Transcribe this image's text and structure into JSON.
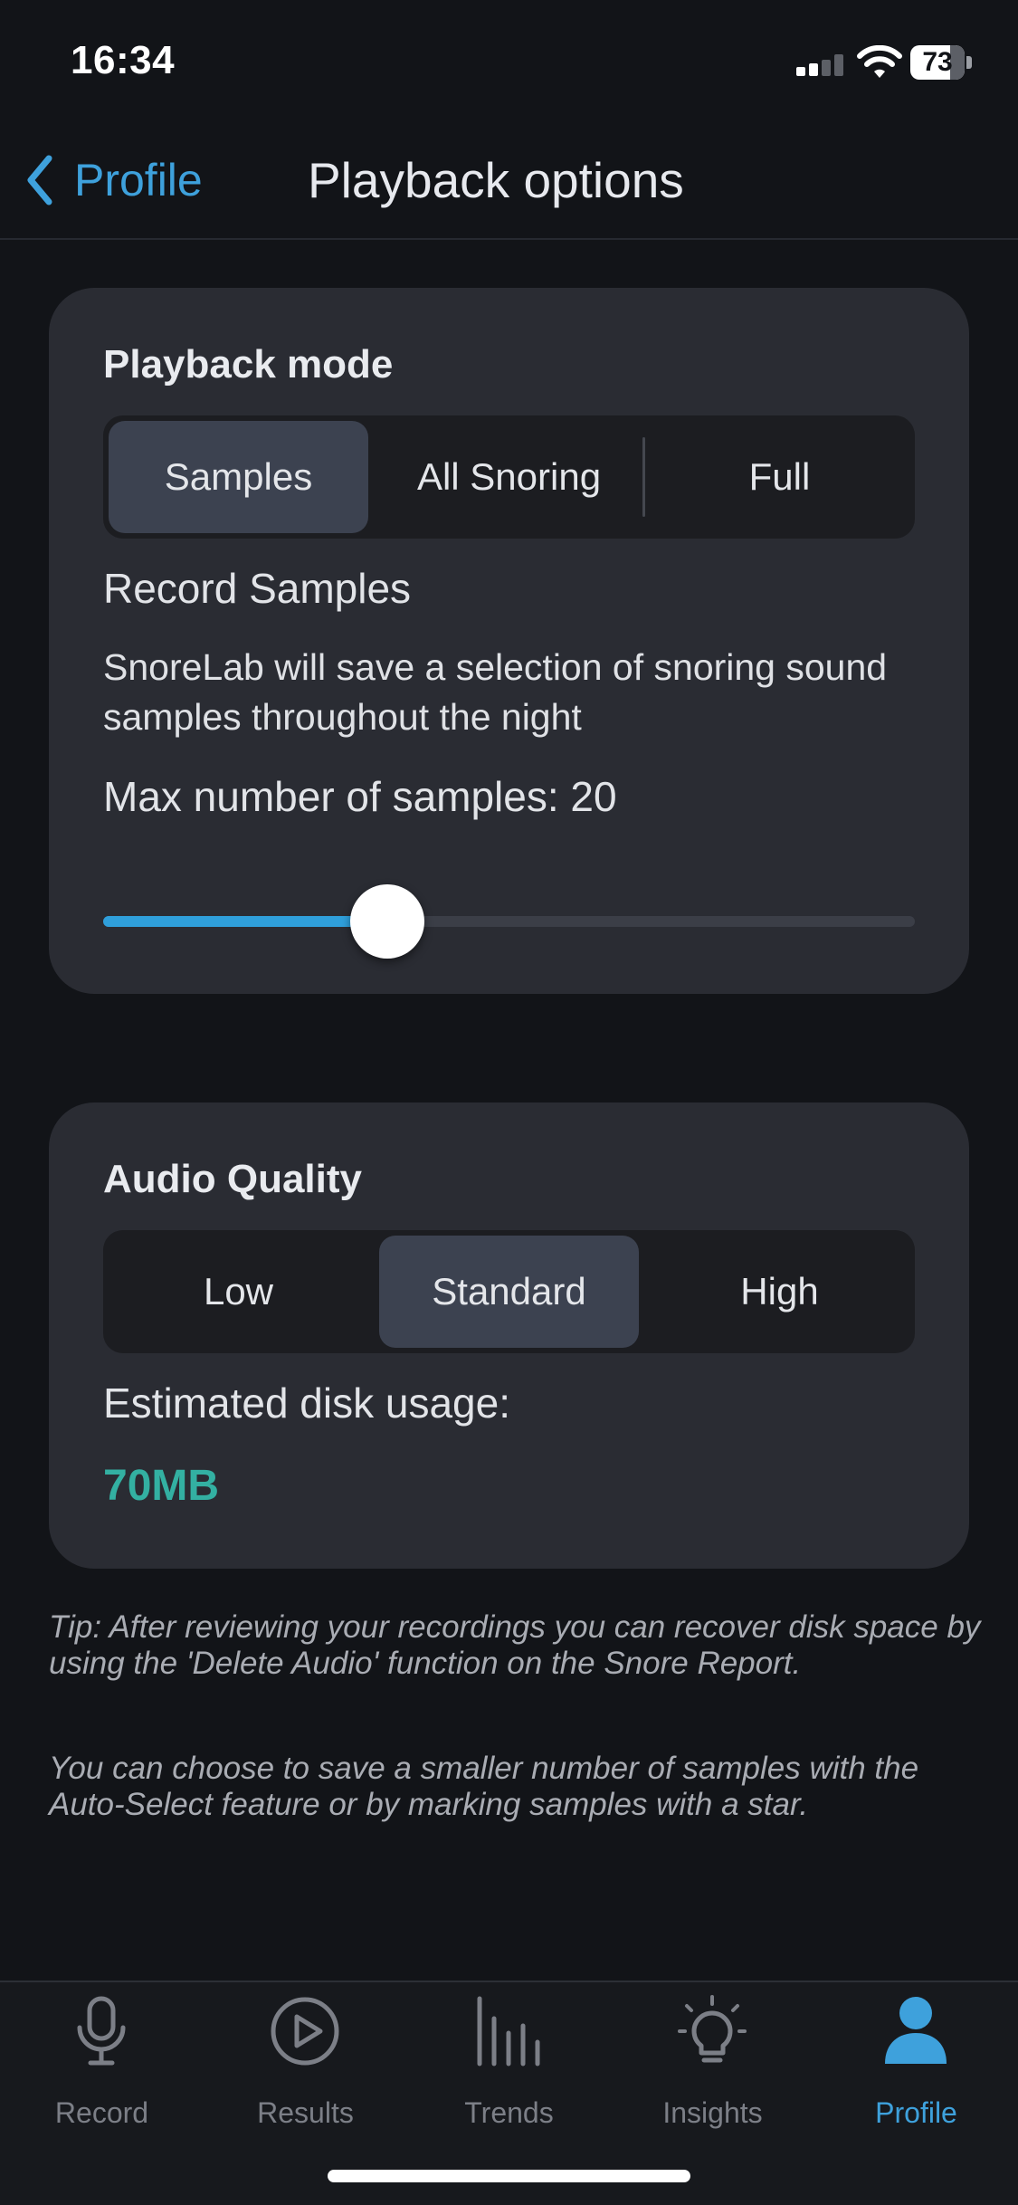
{
  "status_bar": {
    "time": "16:34",
    "battery_percent": "73",
    "battery_level": 0.73,
    "signal_bars": 4,
    "signal_bars_lit": 2,
    "wifi_icon": "wifi-icon"
  },
  "nav": {
    "back_label": "Profile",
    "back_icon": "chevron-left-icon",
    "title": "Playback options"
  },
  "playback": {
    "title": "Playback mode",
    "options": [
      "Samples",
      "All Snoring",
      "Full"
    ],
    "selected_index": 0,
    "mode_heading": "Record Samples",
    "description": "SnoreLab will save a selection of snoring sound samples throughout the night",
    "max_samples_label": "Max number of samples: 20",
    "slider_fraction": 0.35
  },
  "quality": {
    "title": "Audio Quality",
    "options": [
      "Low",
      "Standard",
      "High"
    ],
    "selected_index": 1,
    "disk_label": "Estimated disk usage:",
    "disk_value": "70MB"
  },
  "tips": {
    "tip1": "Tip: After reviewing your recordings you can recover disk space by using the 'Delete Audio' function on the Snore Report.",
    "tip2": "You can choose to save a smaller number of samples with the Auto-Select feature or by marking samples with a star."
  },
  "tab_bar": {
    "tabs": [
      {
        "label": "Record",
        "icon": "microphone-icon"
      },
      {
        "label": "Results",
        "icon": "play-circle-icon"
      },
      {
        "label": "Trends",
        "icon": "bar-chart-icon"
      },
      {
        "label": "Insights",
        "icon": "lightbulb-icon"
      },
      {
        "label": "Profile",
        "icon": "person-icon"
      }
    ],
    "active_index": 4
  },
  "colors": {
    "accent": "#3ea1dc",
    "disk_value": "#33b0a2",
    "card_background": "#2a2c33",
    "page_background": "#121418",
    "segment_selected": "#3c4250",
    "inactive_tab": "#7c7f87"
  }
}
